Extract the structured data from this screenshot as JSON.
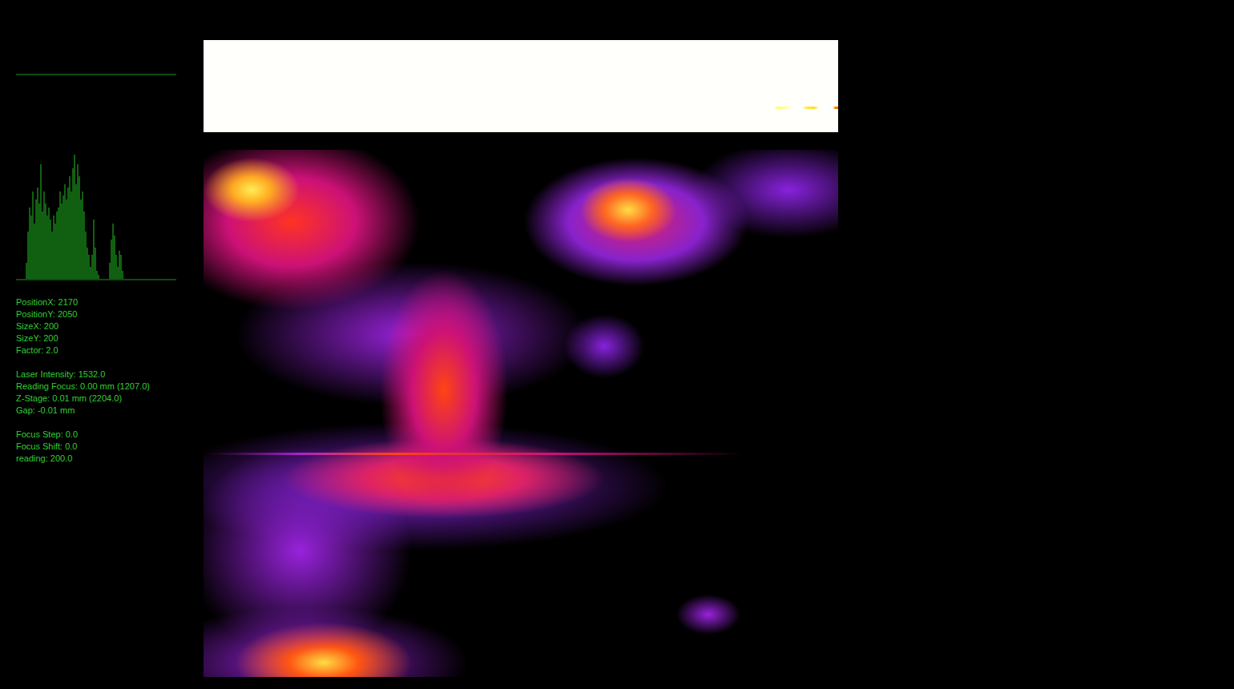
{
  "histogram": {
    "values": [
      0,
      0,
      0,
      0,
      0,
      0,
      20,
      60,
      90,
      80,
      110,
      70,
      100,
      115,
      95,
      145,
      85,
      110,
      95,
      80,
      90,
      75,
      60,
      80,
      70,
      85,
      90,
      110,
      95,
      105,
      120,
      100,
      115,
      130,
      110,
      140,
      157,
      120,
      145,
      130,
      100,
      110,
      85,
      60,
      40,
      30,
      15,
      30,
      75,
      40,
      10,
      5,
      0,
      0,
      0,
      0,
      0,
      0,
      20,
      50,
      70,
      55,
      30,
      15,
      35,
      30,
      10,
      0,
      0,
      0,
      0,
      0,
      0,
      0,
      0,
      0,
      0,
      0,
      0,
      0,
      0,
      0,
      0,
      0,
      0,
      0,
      0,
      0,
      0,
      0,
      0,
      0,
      0,
      0,
      0,
      0,
      0,
      0,
      0,
      0
    ]
  },
  "info": {
    "groups": [
      [
        "PositionX: 2170",
        "PositionY: 2050",
        "SizeX: 200",
        "SizeY: 200",
        "Factor: 2.0"
      ],
      [
        "Laser Intensity: 1532.0",
        "Reading Focus: 0.00 mm (1207.0)",
        "Z-Stage: 0.01 mm (2204.0)",
        "Gap: -0.01 mm"
      ],
      [
        "Focus Step: 0.0",
        "Focus Shift: 0.0",
        "reading: 200.0"
      ]
    ]
  }
}
